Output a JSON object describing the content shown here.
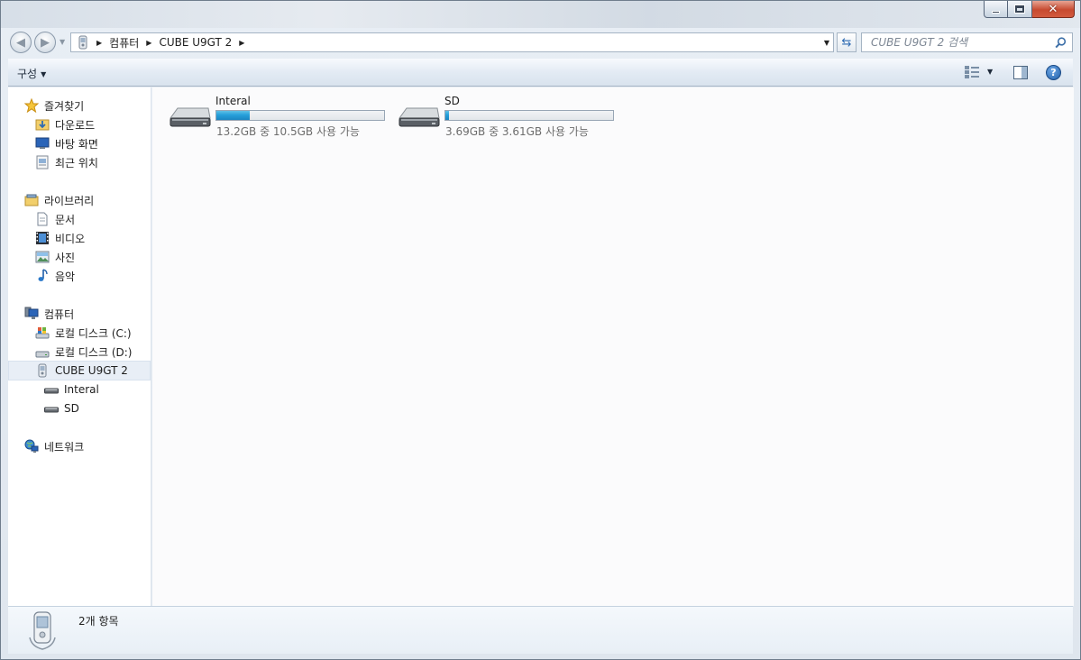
{
  "window": {
    "caption": {
      "minimize": "minimize",
      "maximize": "maximize",
      "close": "✕"
    }
  },
  "address": {
    "breadcrumbs": [
      "컴퓨터",
      "CUBE U9GT 2"
    ],
    "search_placeholder": "CUBE U9GT 2 검색"
  },
  "toolbar": {
    "organize_label": "구성",
    "help_label": "?"
  },
  "navigation": {
    "favorites": {
      "label": "즐겨찾기",
      "items": [
        "다운로드",
        "바탕 화면",
        "최근 위치"
      ]
    },
    "libraries": {
      "label": "라이브러리",
      "items": [
        "문서",
        "비디오",
        "사진",
        "음악"
      ]
    },
    "computer": {
      "label": "컴퓨터",
      "items": [
        "로컬 디스크 (C:)",
        "로컬 디스크 (D:)",
        "CUBE U9GT 2"
      ],
      "device_children": [
        "Interal",
        "SD"
      ],
      "selected": "CUBE U9GT 2"
    },
    "network": {
      "label": "네트워크"
    }
  },
  "drives": [
    {
      "name": "Interal",
      "space": "13.2GB 중 10.5GB 사용 가능",
      "used_fraction": 0.2
    },
    {
      "name": "SD",
      "space": "3.69GB 중 3.61GB 사용 가능",
      "used_fraction": 0.02
    }
  ],
  "details": {
    "item_count": "2개 항목"
  },
  "colors": {
    "progress": "#26a0da",
    "close": "#c74a30",
    "accent": "#1f5ea8"
  },
  "icons": {
    "favorites": "star-icon",
    "downloads": "download-folder-icon",
    "desktop": "desktop-icon",
    "recent": "recent-places-icon",
    "libraries": "library-icon",
    "documents": "document-icon",
    "videos": "video-icon",
    "pictures": "picture-icon",
    "music": "music-note-icon",
    "computer": "computer-icon",
    "disk": "hard-disk-icon",
    "device": "portable-device-icon",
    "drive": "removable-drive-icon",
    "network": "network-icon"
  }
}
